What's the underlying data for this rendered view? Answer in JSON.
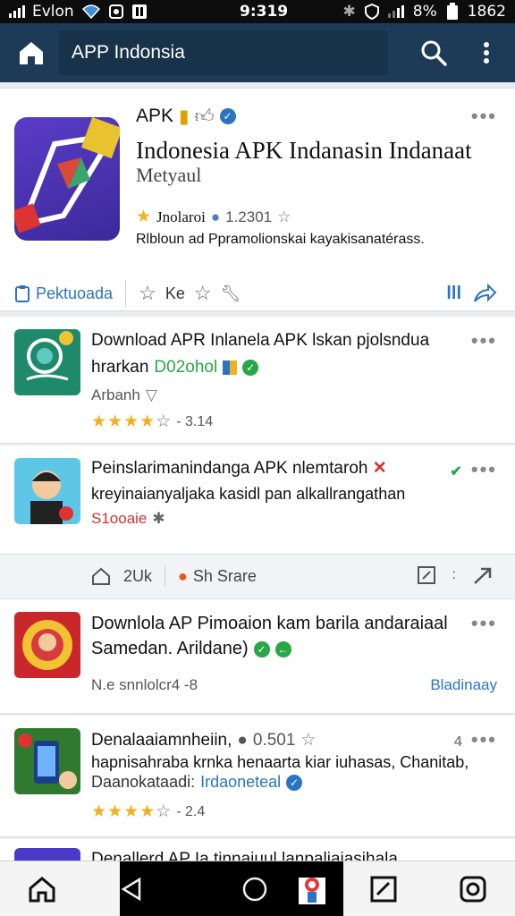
{
  "status_bar": {
    "carrier": "Evlon",
    "time": "9:319",
    "battery": "8%",
    "right_time": "1862"
  },
  "app_bar": {
    "search_text": "APP Indonsia"
  },
  "featured": {
    "name": "APK",
    "title": "Indonesia APK Indanasin Indanaat",
    "subtitle": "Metyaul",
    "publisher": "Jnolaroi",
    "rating": "1.2301",
    "description": "Rlbloun ad Ppramolionskai kayakisanatérass.",
    "download_label": "Pektuoada",
    "rate_label": "Ke",
    "colors": {
      "icon_bg": "#4a35b8",
      "accent": "#2a74c4"
    }
  },
  "list": [
    {
      "line1": "Download APR Inlanela APK lskan pjolsndua",
      "line2": "hrarkan",
      "badge": "D02ohol",
      "line3": "Arbanh",
      "rating_text": "- 3.14",
      "stars": 3.5
    },
    {
      "line1": "Peinslarimanindanga APK nlemtaroh",
      "line2": "kreyinaianyaljaka kasidl pan alkallrangathan",
      "line3": "S1ooaie"
    },
    {
      "line1": "Downlola AP Pimoaion kam barila andaraiaal",
      "line2": "Samedan. Arildane)",
      "line3": "N.e snnlolcr4 -8",
      "link": "Bladinaay"
    },
    {
      "line1": "Denalaaiamnheiin,",
      "rating_inline": "0.501",
      "line2": "hapnisahraba krnka henaarta kiar iuhasas, Chanitab,",
      "line3a": "Daanokataadi:",
      "line3b": "Irdaoneteal",
      "rating_text": "- 2.4",
      "stars": 3.5,
      "count": "4"
    },
    {
      "line1": "Denallerd AP Ia tinnaiuul lanpaliaiasihala"
    }
  ],
  "action_strip": {
    "count": "2Uk",
    "store_label": "Sh Srare"
  }
}
